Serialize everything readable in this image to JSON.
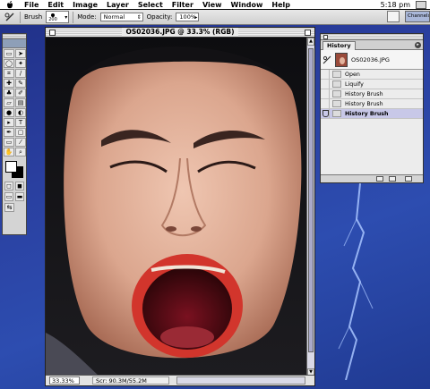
{
  "menubar": {
    "items": [
      "File",
      "Edit",
      "Image",
      "Layer",
      "Select",
      "Filter",
      "View",
      "Window",
      "Help"
    ],
    "clock": "5:18 pm"
  },
  "options": {
    "brush_label": "Brush",
    "brush_size": "200",
    "mode_label": "Mode:",
    "mode_value": "Normal",
    "opacity_label": "Opacity:",
    "opacity_value": "100%",
    "palette_well_label": "Channels"
  },
  "document": {
    "title": "OS02036.JPG @ 33.3% (RGB)",
    "zoom": "33.33%",
    "scratch": "Scr: 90.3M/55.2M"
  },
  "history": {
    "tab": "History",
    "snapshot": "OS02036.JPG",
    "states": [
      {
        "label": "Open",
        "active": false
      },
      {
        "label": "Liquify",
        "active": false
      },
      {
        "label": "History Brush",
        "active": false
      },
      {
        "label": "History Brush",
        "active": false
      },
      {
        "label": "History Brush",
        "active": true
      }
    ]
  },
  "colors": {
    "desktop": "#2a3f9f",
    "skin": "#e2b39d",
    "lips": "#d2352c"
  }
}
